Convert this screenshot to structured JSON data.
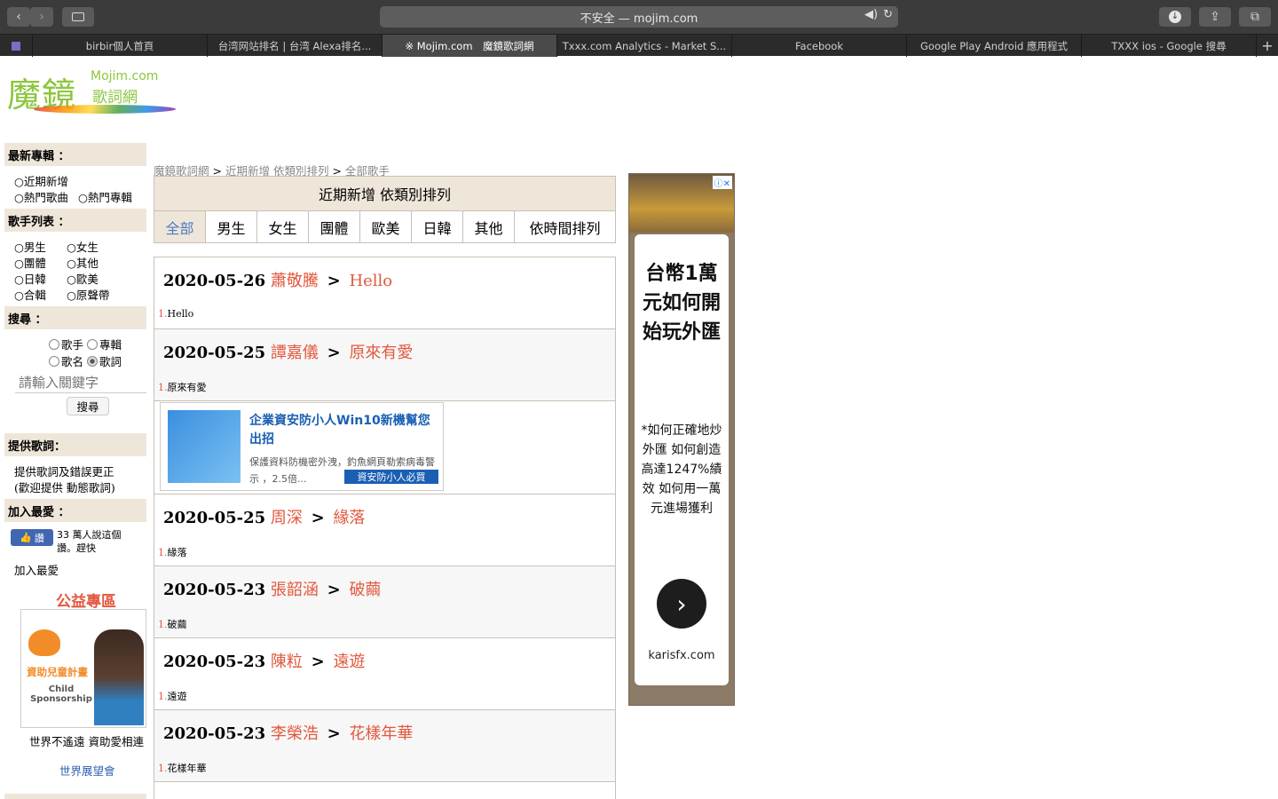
{
  "browser": {
    "url_text": "不安全 — mojim.com",
    "tabs": [
      {
        "label": "birbir個人首頁",
        "active": false
      },
      {
        "label": "台湾网站排名 | 台湾 Alexa排名...",
        "active": false
      },
      {
        "label": "※ Mojim.com　魔鏡歌詞網",
        "active": true
      },
      {
        "label": "Txxx.com Analytics - Market S...",
        "active": false
      },
      {
        "label": "Facebook",
        "active": false
      },
      {
        "label": "Google Play Android 應用程式",
        "active": false
      },
      {
        "label": "TXXX ios - Google 搜尋",
        "active": false
      }
    ]
  },
  "logo": {
    "cn": "魔鏡",
    "en": "Mojim.com",
    "cn_sub": "歌詞網"
  },
  "sidebar": {
    "latest_head": "最新專輯 ：",
    "latest_links": [
      "○近期新增",
      "○熱門歌曲",
      "○熱門專輯"
    ],
    "artists_head": "歌手列表 ：",
    "artist_links": [
      "○男生",
      "○女生",
      "○團體",
      "○其他",
      "○日韓",
      "○歐美",
      "○合輯",
      "○原聲帶"
    ],
    "search_head": "搜尋 ：",
    "radio_labels": [
      "歌手",
      "專輯",
      "歌名",
      "歌詞"
    ],
    "search_placeholder": "請輸入關鍵字",
    "search_button": "搜尋",
    "submit_head": "提供歌詞：",
    "submit_text1": "提供歌詞及錯誤更正",
    "submit_text2": "(歡迎提供 動態歌詞)",
    "fav_head": "加入最愛 ：",
    "like_label": "讚",
    "like_text": "33 萬人說這個讚。趕快",
    "fav_link": "加入最愛",
    "charity_title": "公益專區",
    "charity_img_cn": "資助兒童計畫",
    "charity_img_en": "Child Sponsorship",
    "charity_caption": "世界不遙遠 資助愛相連",
    "charity_org": "世界展望會"
  },
  "breadcrumb": {
    "home": "魔鏡歌詞網",
    "level2": "近期新增 依類別排列",
    "level3": "全部歌手",
    "sep": ">"
  },
  "panel": {
    "title": "近期新增 依類別排列",
    "categories": [
      "全部",
      "男生",
      "女生",
      "團體",
      "歐美",
      "日韓",
      "其他",
      "依時間排列"
    ],
    "active_category": "全部"
  },
  "entries": [
    {
      "date": "2020-05-26",
      "artist": "蕭敬騰",
      "song": "Hello",
      "track_no": "1.",
      "track": "Hello"
    },
    {
      "date": "2020-05-25",
      "artist": "譚嘉儀",
      "song": "原來有愛",
      "track_no": "1.",
      "track": "原來有愛"
    },
    {
      "date": "2020-05-25",
      "artist": "周深",
      "song": "緣落",
      "track_no": "1.",
      "track": "緣落"
    },
    {
      "date": "2020-05-23",
      "artist": "張韶涵",
      "song": "破繭",
      "track_no": "1.",
      "track": "破繭"
    },
    {
      "date": "2020-05-23",
      "artist": "陳粒",
      "song": "遠遊",
      "track_no": "1.",
      "track": "遠遊"
    },
    {
      "date": "2020-05-23",
      "artist": "李榮浩",
      "song": "花樣年華",
      "track_no": "1.",
      "track": "花樣年華"
    }
  ],
  "arrow_glyph": ">",
  "ad_inline": {
    "title": "企業資安防小人Win10新機幫您出招",
    "desc": "保護資料防機密外洩，釣魚網頁勒索病毒警示 ，2.5倍...",
    "cta": "資安防小人必買"
  },
  "ad_side": {
    "headline": "台幣1萬元如何開始玩外匯",
    "body": "*如何正確地炒外匯 如何創造高達1247%績效 如何用一萬元進場獲利",
    "site": "karisfx.com",
    "arrow": "›"
  }
}
